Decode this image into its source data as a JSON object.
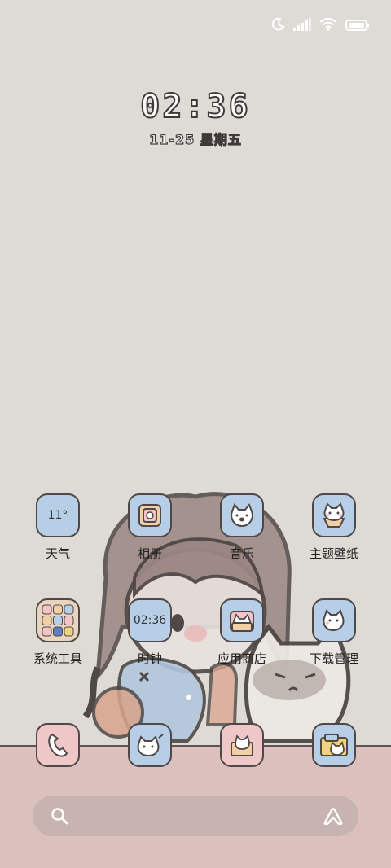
{
  "status_bar": {
    "icons": [
      "moon-icon",
      "signal-icon",
      "wifi-icon",
      "battery-icon"
    ]
  },
  "clock": {
    "time": "02:36",
    "date": "11-25 星期五"
  },
  "apps_row1": [
    {
      "label": "天气",
      "tile_text": "11°",
      "icon": "weather-icon"
    },
    {
      "label": "相册",
      "icon": "gallery-icon"
    },
    {
      "label": "音乐",
      "icon": "music-icon"
    },
    {
      "label": "主题壁纸",
      "icon": "themes-icon"
    }
  ],
  "apps_row2": [
    {
      "label": "系统工具",
      "icon": "system-tools-folder-icon"
    },
    {
      "label": "时钟",
      "tile_text": "02:36",
      "icon": "clock-icon"
    },
    {
      "label": "应用商店",
      "icon": "app-store-icon"
    },
    {
      "label": "下载管理",
      "icon": "downloads-icon"
    }
  ],
  "dock": [
    {
      "icon": "phone-icon"
    },
    {
      "icon": "messages-icon"
    },
    {
      "icon": "mail-icon"
    },
    {
      "icon": "files-icon"
    }
  ],
  "colors": {
    "background": "#dedad5",
    "floor": "#dbc0bd",
    "tile_blue": "#b7cfe6",
    "tile_pink": "#efc7c9",
    "outline": "#4f4846"
  }
}
